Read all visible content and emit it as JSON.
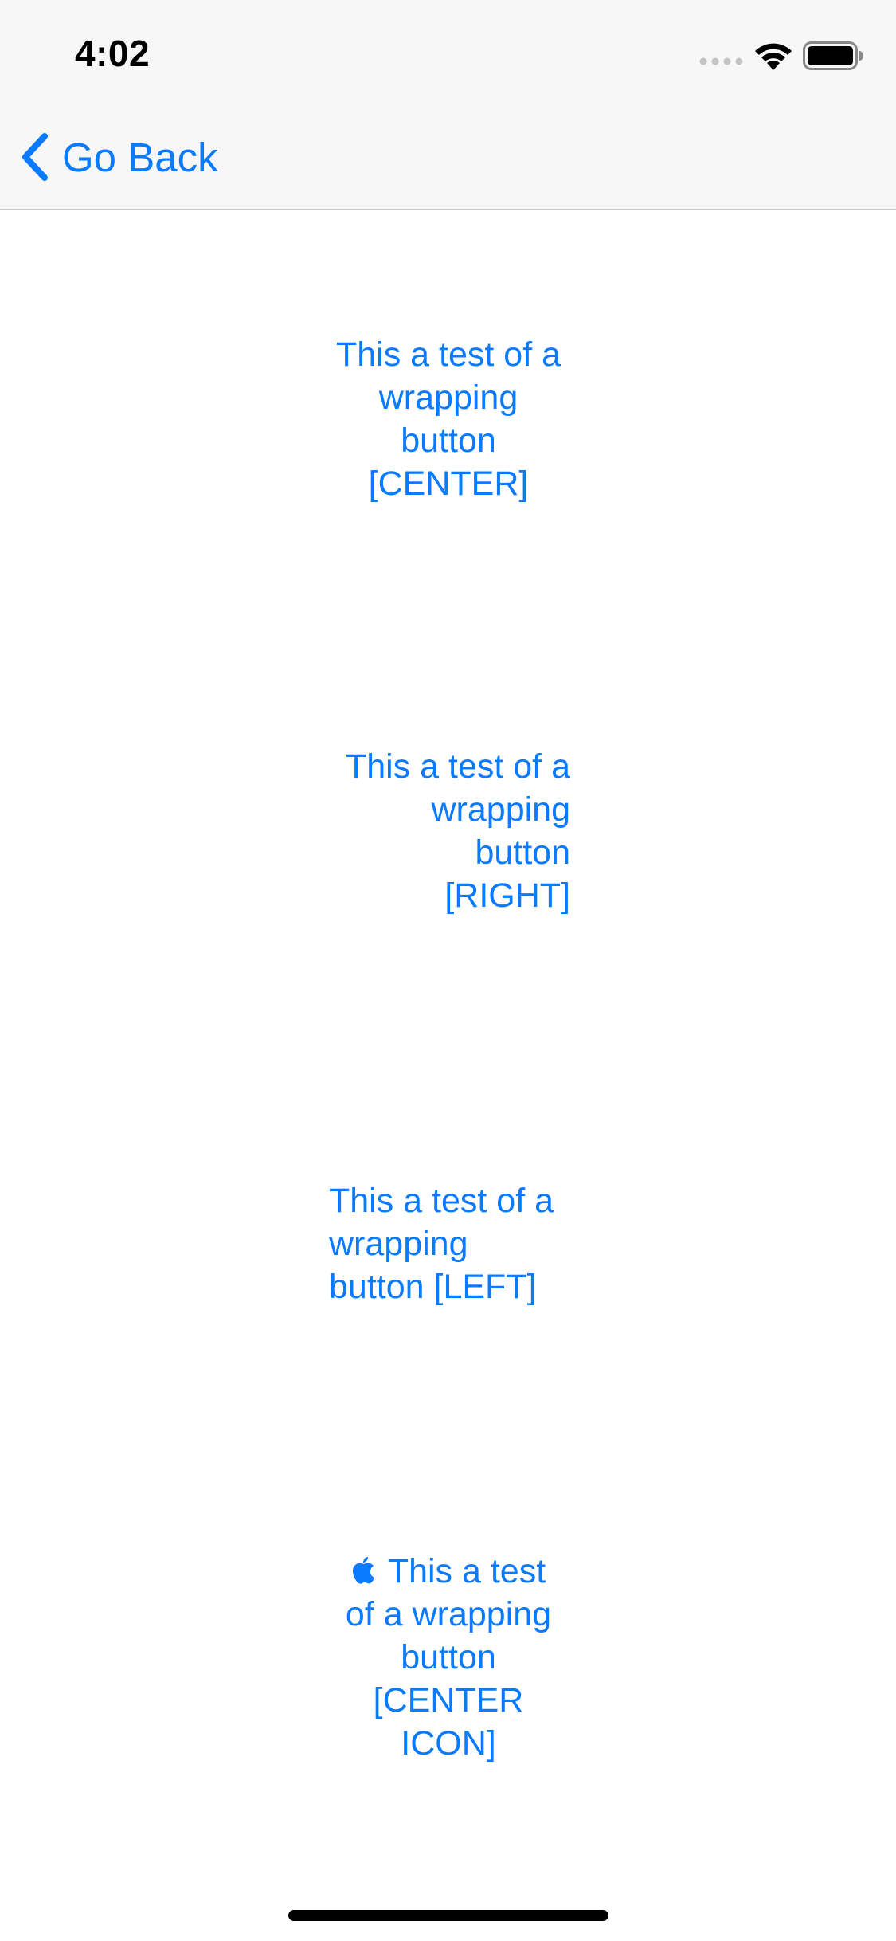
{
  "status_bar": {
    "time": "4:02",
    "signal_icon": "cellular-dots-icon",
    "wifi_icon": "wifi-icon",
    "battery_icon": "battery-icon"
  },
  "nav": {
    "back_icon": "chevron-left-icon",
    "back_label": "Go Back"
  },
  "buttons": [
    {
      "label": "This a test of a wrapping button [CENTER]",
      "align": "center"
    },
    {
      "label": "This a test of a wrapping button [RIGHT]",
      "align": "right"
    },
    {
      "label": "This a test of a wrapping button [LEFT]",
      "align": "left"
    },
    {
      "label": "This a test of a wrapping button [CENTER ICON]",
      "align": "center",
      "icon": "apple-logo-icon"
    }
  ],
  "colors": {
    "accent": "#0a7aff",
    "bar_background": "#f7f7f7",
    "background": "#ffffff"
  }
}
